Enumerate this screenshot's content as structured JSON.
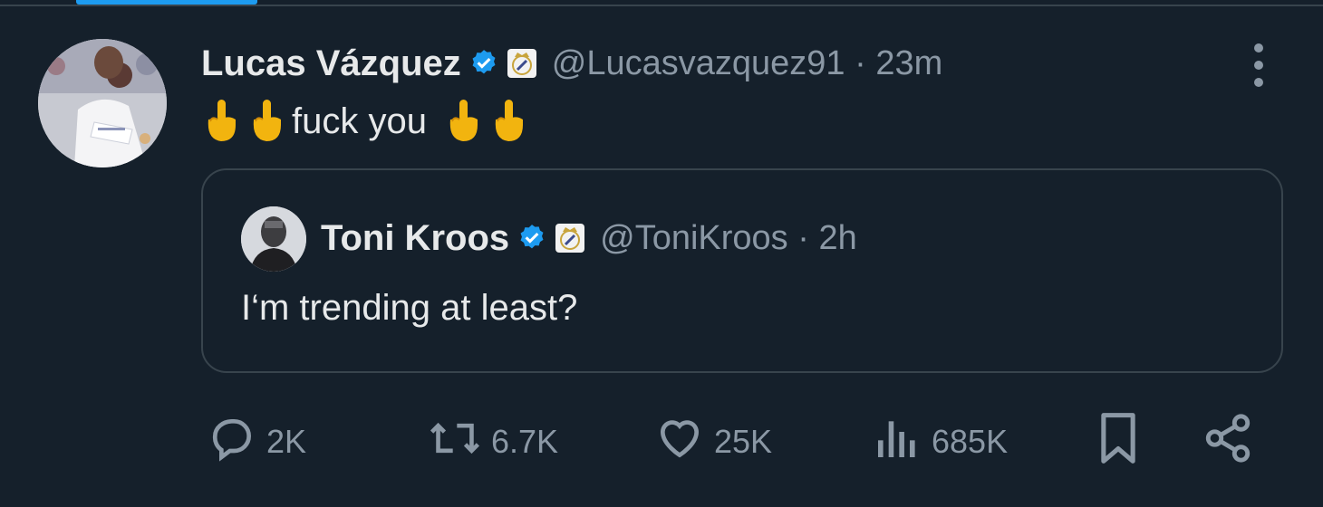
{
  "tweet": {
    "author_name": "Lucas Vázquez",
    "handle": "@Lucasvazquez91",
    "time": "· 23m",
    "text": "fuck you",
    "emoji_before": [
      "middle-finger",
      "middle-finger"
    ],
    "emoji_after": [
      "middle-finger",
      "middle-finger"
    ]
  },
  "quoted": {
    "author_name": "Toni Kroos",
    "handle": "@ToniKroos",
    "time": "· 2h",
    "text": "I‘m trending at least?"
  },
  "actions": {
    "replies": "2K",
    "retweets": "6.7K",
    "likes": "25K",
    "views": "685K"
  },
  "icons": [
    "reply-icon",
    "retweet-icon",
    "like-icon",
    "views-icon",
    "bookmark-icon",
    "share-icon",
    "verified-icon",
    "club-badge-icon",
    "more-icon"
  ],
  "colors": {
    "background": "#15202b",
    "text": "#e7e9ea",
    "muted": "#8b98a5",
    "verified": "#1d9bf0",
    "border": "#38444d",
    "emoji": "#f2b40f"
  }
}
